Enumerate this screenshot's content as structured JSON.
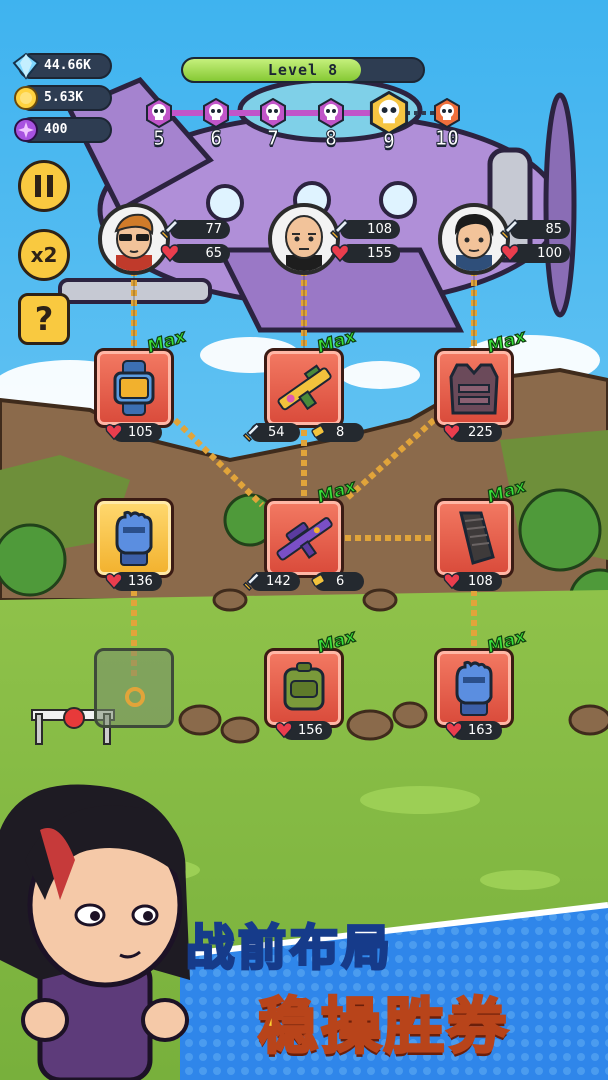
{
  "resources": {
    "gems": "44.66K",
    "coins": "5.63K",
    "orbs": "400"
  },
  "level": {
    "label": "Level 8",
    "progress": 0.74
  },
  "stages": [
    "5",
    "6",
    "7",
    "8",
    "9",
    "10"
  ],
  "buttons": {
    "speed": "x2",
    "help": "?"
  },
  "heroes": [
    {
      "attack": "77",
      "hp": "65"
    },
    {
      "attack": "108",
      "hp": "155"
    },
    {
      "attack": "85",
      "hp": "100"
    }
  ],
  "items": [
    {
      "name": "watch",
      "max": "Max",
      "hp": "105"
    },
    {
      "name": "rifle",
      "max": "Max",
      "attack": "54",
      "speed": "8"
    },
    {
      "name": "vest",
      "max": "Max",
      "hp": "225"
    },
    {
      "name": "glove",
      "hp": "136"
    },
    {
      "name": "rifle-2",
      "max": "Max",
      "attack": "142",
      "speed": "6"
    },
    {
      "name": "magazine",
      "max": "Max",
      "hp": "108"
    },
    {
      "name": "pack",
      "max": "Max",
      "hp": "156"
    },
    {
      "name": "glove-2",
      "max": "Max",
      "hp": "163"
    }
  ],
  "banner": {
    "line1": "战前布局",
    "line2": "稳操胜券"
  },
  "colors": {
    "item_red": "#e05a48",
    "item_gold": "#f2b12d",
    "max_green": "#38e038",
    "level_green": "#86c934",
    "stage_purple": "#c155c9",
    "banner_yellow": "#ffd532"
  }
}
